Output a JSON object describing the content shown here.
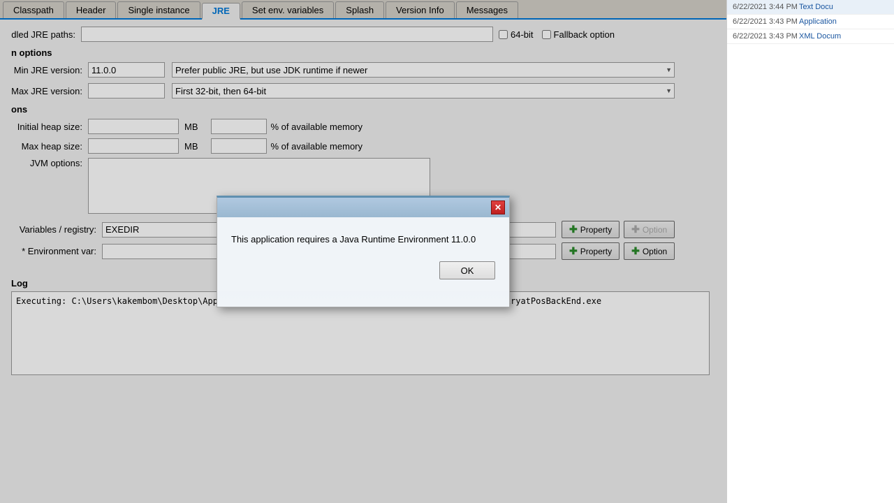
{
  "tabs": [
    {
      "id": "classpath",
      "label": "Classpath"
    },
    {
      "id": "header",
      "label": "Header"
    },
    {
      "id": "single-instance",
      "label": "Single instance"
    },
    {
      "id": "jre",
      "label": "JRE",
      "active": true
    },
    {
      "id": "set-env",
      "label": "Set env. variables"
    },
    {
      "id": "splash",
      "label": "Splash"
    },
    {
      "id": "version-info",
      "label": "Version Info"
    },
    {
      "id": "messages",
      "label": "Messages"
    }
  ],
  "bundled_jre": {
    "label": "dled JRE paths:",
    "value": "",
    "checkbox_64bit": "64-bit",
    "checkbox_fallback": "Fallback option"
  },
  "jre_options": {
    "section_label": "n options",
    "min_version_label": "Min JRE version:",
    "min_version_value": "11.0.0",
    "max_version_label": "Max JRE version:",
    "max_version_value": "",
    "dropdown1_value": "Prefer public JRE, but use JDK runtime if newer",
    "dropdown2_value": "First 32-bit, then 64-bit"
  },
  "heap": {
    "section_label": "ons",
    "initial_label": "Initial heap size:",
    "initial_mb": "",
    "initial_pct": "",
    "max_label": "Max heap size:",
    "max_mb": "",
    "max_pct": "",
    "jvm_label": "JVM options:",
    "mb_unit": "MB",
    "pct_text": "% of available memory"
  },
  "variables": {
    "registry_label": "Variables / registry:",
    "registry_value": "EXEDIR",
    "env_var_label": "* Environment var:",
    "env_var_value": "",
    "property_btn": "Property",
    "option_btn": "Option"
  },
  "log": {
    "title": "Log",
    "content": "Executing: C:\\Users\\kakembom\\Desktop\\Apps Deploy\\SiriatPos\\deployFiles\\siryatPosBackEndLaunch4J\\siryatPosBackEnd.exe"
  },
  "dialog": {
    "message": "This application requires a Java Runtime Environment 11.0.0",
    "ok_label": "OK",
    "close_symbol": "✕"
  },
  "right_panel": {
    "rows": [
      {
        "date": "6/22/2021 3:44 PM",
        "type": "Text Docu"
      },
      {
        "date": "6/22/2021 3:43 PM",
        "type": "Application"
      },
      {
        "date": "6/22/2021 3:43 PM",
        "type": "XML Docum"
      }
    ]
  }
}
